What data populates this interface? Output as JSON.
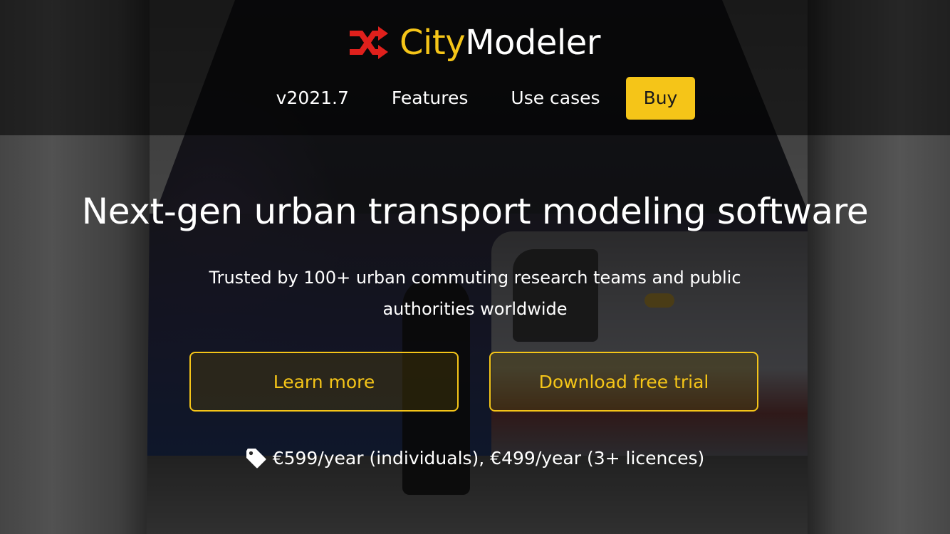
{
  "brand": {
    "name_part1": "City",
    "name_part2": "Modeler",
    "icon": "shuffle-icon",
    "colors": {
      "accent": "#f5c518",
      "icon": "#e0201c",
      "text": "#ffffff"
    }
  },
  "nav": {
    "items": [
      {
        "label": "v2021.7"
      },
      {
        "label": "Features"
      },
      {
        "label": "Use cases"
      }
    ],
    "buy_label": "Buy"
  },
  "hero": {
    "title": "Next-gen urban transport modeling software",
    "subtitle": "Trusted by 100+ urban commuting research teams and public authorities worldwide"
  },
  "buttons": {
    "learn_more": "Learn more",
    "download_trial": "Download free trial"
  },
  "pricing": {
    "icon": "price-tag-icon",
    "text": "€599/year (individuals), €499/year (3+ licences)"
  }
}
